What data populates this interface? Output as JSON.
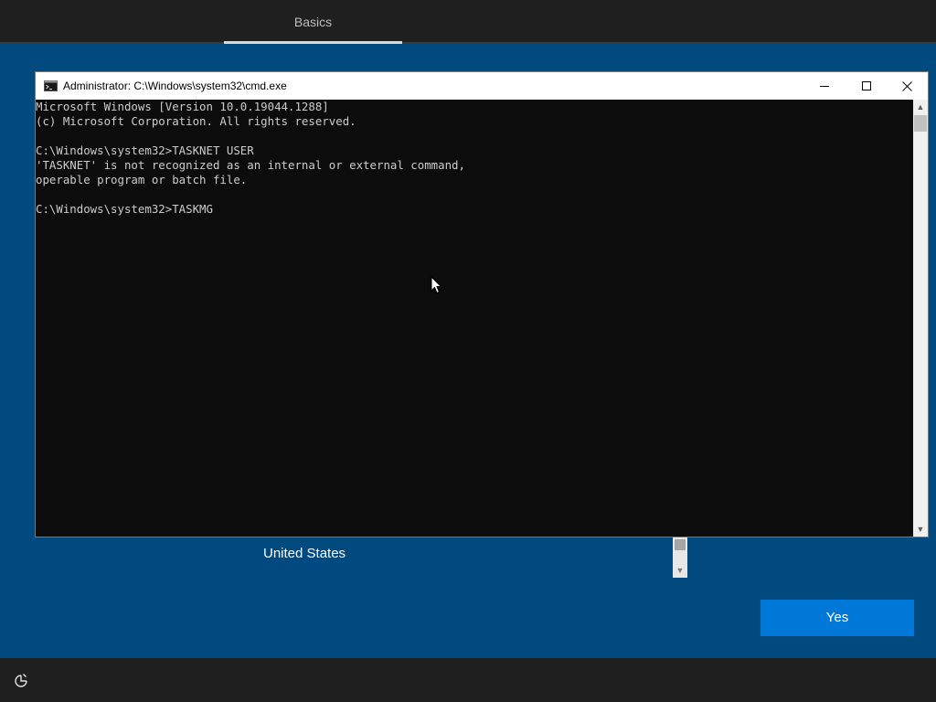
{
  "oobe": {
    "tab_label": "Basics",
    "region_item": "United States",
    "yes_button_label": "Yes",
    "accent_color": "#0078d7",
    "background_color": "#004a80"
  },
  "cmd": {
    "title": "Administrator: C:\\Windows\\system32\\cmd.exe",
    "output": "Microsoft Windows [Version 10.0.19044.1288]\n(c) Microsoft Corporation. All rights reserved.\n\nC:\\Windows\\system32>TASKNET USER\n'TASKNET' is not recognized as an internal or external command,\noperable program or batch file.\n\nC:\\Windows\\system32>TASKMG",
    "icons": {
      "app": "cmd-app-icon",
      "minimize": "minimize-icon",
      "maximize": "maximize-icon",
      "close": "close-icon"
    }
  },
  "bottom": {
    "icon": "accessibility-icon"
  }
}
